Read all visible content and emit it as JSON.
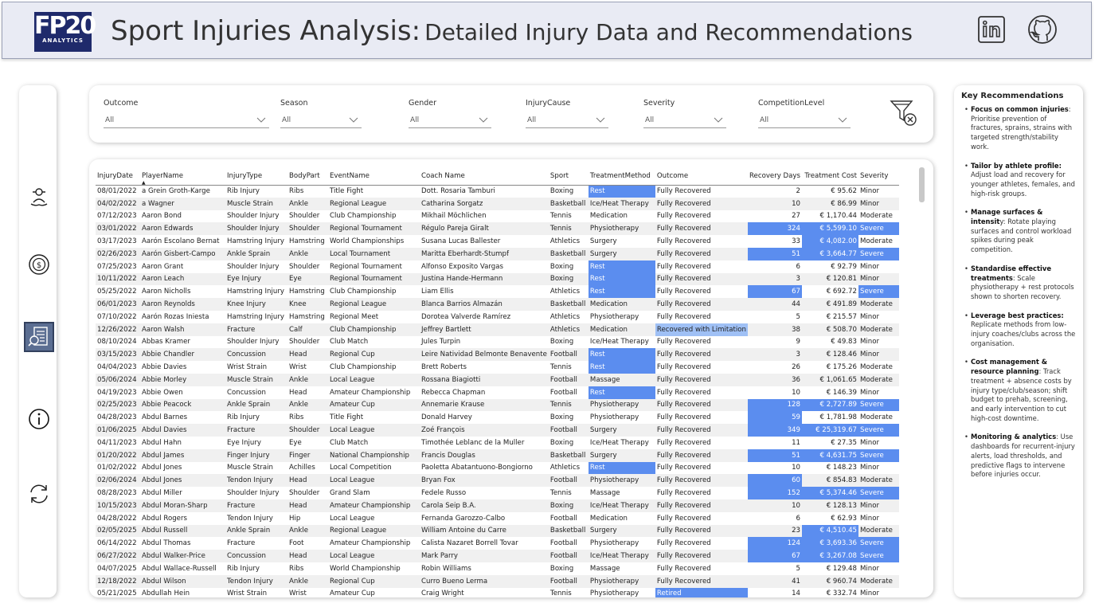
{
  "header": {
    "logo_text": "FP20",
    "logo_sub": "ANALYTICS",
    "title_main": "Sport Injuries Analysis:",
    "title_sub": "Detailed Injury Data and Recommendations",
    "icons": [
      "linkedin-icon",
      "github-icon"
    ]
  },
  "nav": {
    "items": [
      "rehab-icon",
      "cost-icon",
      "report-icon",
      "info-icon",
      "refresh-icon"
    ],
    "active": "report-icon"
  },
  "filters": [
    {
      "label": "Outcome",
      "value": "All"
    },
    {
      "label": "Season",
      "value": "All"
    },
    {
      "label": "Gender",
      "value": "All"
    },
    {
      "label": "InjuryCause",
      "value": "All"
    },
    {
      "label": "Severity",
      "value": "All"
    },
    {
      "label": "CompetitionLevel",
      "value": "All"
    }
  ],
  "table": {
    "columns": [
      "InjuryDate",
      "PlayerName",
      "InjuryType",
      "BodyPart",
      "EventName",
      "Coach Name",
      "Sport",
      "TreatmentMethod",
      "Outcome",
      "Recovery Days",
      "Treatment Cost",
      "Severity"
    ],
    "rows": [
      [
        "08/01/2022",
        "a Grein Groth-Karge",
        "Rib Injury",
        "Ribs",
        "Title Fight",
        "Dott. Rosaria Tamburi",
        "Boxing",
        "Rest",
        "Fully Recovered",
        "2",
        "€ 95.62",
        "Minor"
      ],
      [
        "04/02/2022",
        "a Wagner",
        "Muscle Strain",
        "Ankle",
        "Regional League",
        "Catharina Sorgatz",
        "Basketball",
        "Ice/Heat Therapy",
        "Fully Recovered",
        "10",
        "€ 86.99",
        "Minor"
      ],
      [
        "07/12/2023",
        "Aaron Bond",
        "Shoulder Injury",
        "Shoulder",
        "Club Championship",
        "Mikhail Möchlichen",
        "Tennis",
        "Medication",
        "Fully Recovered",
        "27",
        "€ 1,170.44",
        "Moderate"
      ],
      [
        "03/01/2022",
        "Aaron Edwards",
        "Shoulder Injury",
        "Shoulder",
        "Regional Tournament",
        "Régulo Pareja Giralt",
        "Tennis",
        "Physiotherapy",
        "Fully Recovered",
        "324",
        "€ 5,599.10",
        "Severe"
      ],
      [
        "03/17/2023",
        "Aarón Escolano Bernat",
        "Hamstring Injury",
        "Hamstring",
        "World Championships",
        "Susana Lucas Ballester",
        "Athletics",
        "Surgery",
        "Fully Recovered",
        "33",
        "€ 4,082.00",
        "Moderate"
      ],
      [
        "02/26/2023",
        "Aarón Gisbert-Campo",
        "Ankle Sprain",
        "Ankle",
        "Local Tournament",
        "Maritta Eberhardt-Stumpf",
        "Basketball",
        "Surgery",
        "Fully Recovered",
        "51",
        "€ 3,664.77",
        "Severe"
      ],
      [
        "07/25/2023",
        "Aaron Grant",
        "Shoulder Injury",
        "Shoulder",
        "Regional Tournament",
        "Alfonso Exposito Vargas",
        "Boxing",
        "Rest",
        "Fully Recovered",
        "6",
        "€ 92.79",
        "Minor"
      ],
      [
        "10/11/2022",
        "Aaron Leach",
        "Eye Injury",
        "Eye",
        "Regional Tournament",
        "Justina Hande-Hermann",
        "Boxing",
        "Rest",
        "Fully Recovered",
        "3",
        "€ 120.81",
        "Minor"
      ],
      [
        "05/25/2022",
        "Aaron Nicholls",
        "Hamstring Injury",
        "Hamstring",
        "Club Championship",
        "Liam Ellis",
        "Athletics",
        "Rest",
        "Fully Recovered",
        "67",
        "€ 692.72",
        "Severe"
      ],
      [
        "06/01/2023",
        "Aaron Reynolds",
        "Knee Injury",
        "Knee",
        "Regional League",
        "Blanca Barrios Almazán",
        "Basketball",
        "Medication",
        "Fully Recovered",
        "44",
        "€ 491.89",
        "Moderate"
      ],
      [
        "07/10/2022",
        "Aarón Rozas Iniesta",
        "Hamstring Injury",
        "Hamstring",
        "Regional Meet",
        "Dorotea Valverde Ramírez",
        "Athletics",
        "Physiotherapy",
        "Fully Recovered",
        "5",
        "€ 215.57",
        "Minor"
      ],
      [
        "12/26/2022",
        "Aaron Walsh",
        "Fracture",
        "Calf",
        "Club Championship",
        "Jeffrey Bartlett",
        "Athletics",
        "Medication",
        "Recovered with Limitation",
        "38",
        "€ 508.70",
        "Moderate"
      ],
      [
        "08/10/2024",
        "Abbas Kramer",
        "Shoulder Injury",
        "Shoulder",
        "Club Match",
        "Jules Turpin",
        "Boxing",
        "Ice/Heat Therapy",
        "Fully Recovered",
        "9",
        "€ 49.83",
        "Minor"
      ],
      [
        "03/15/2023",
        "Abbie Chandler",
        "Concussion",
        "Head",
        "Regional Cup",
        "Leire Natividad Belmonte Benavente",
        "Football",
        "Rest",
        "Fully Recovered",
        "3",
        "€ 128.46",
        "Minor"
      ],
      [
        "04/04/2023",
        "Abbie Davies",
        "Wrist Strain",
        "Wrist",
        "Club Championship",
        "Brett Roberts",
        "Tennis",
        "Rest",
        "Fully Recovered",
        "26",
        "€ 175.26",
        "Moderate"
      ],
      [
        "05/06/2024",
        "Abbie Morley",
        "Muscle Strain",
        "Ankle",
        "Local League",
        "Rossana Biagiotti",
        "Football",
        "Massage",
        "Fully Recovered",
        "36",
        "€ 1,061.65",
        "Moderate"
      ],
      [
        "04/19/2023",
        "Abbie Owen",
        "Concussion",
        "Head",
        "Amateur Championship",
        "Rebecca Chapman",
        "Football",
        "Rest",
        "Fully Recovered",
        "10",
        "€ 146.39",
        "Minor"
      ],
      [
        "02/25/2023",
        "Abbie Peacock",
        "Ankle Sprain",
        "Ankle",
        "Amateur Cup",
        "Annemarie Krause",
        "Tennis",
        "Physiotherapy",
        "Fully Recovered",
        "128",
        "€ 2,727.89",
        "Severe"
      ],
      [
        "04/28/2023",
        "Abdul Barnes",
        "Rib Injury",
        "Ribs",
        "Title Fight",
        "Donald Harvey",
        "Boxing",
        "Physiotherapy",
        "Fully Recovered",
        "59",
        "€ 1,781.98",
        "Moderate"
      ],
      [
        "01/06/2025",
        "Abdul Davies",
        "Fracture",
        "Shoulder",
        "Local League",
        "Zoé François",
        "Football",
        "Surgery",
        "Fully Recovered",
        "349",
        "€ 25,319.67",
        "Severe"
      ],
      [
        "04/11/2023",
        "Abdul Hahn",
        "Eye Injury",
        "Eye",
        "Club Match",
        "Timothée Leblanc de la Muller",
        "Boxing",
        "Ice/Heat Therapy",
        "Fully Recovered",
        "11",
        "€ 27.35",
        "Minor"
      ],
      [
        "01/20/2022",
        "Abdul James",
        "Finger Injury",
        "Finger",
        "National Championship",
        "Francis Douglas",
        "Basketball",
        "Surgery",
        "Fully Recovered",
        "51",
        "€ 4,631.75",
        "Severe"
      ],
      [
        "01/02/2022",
        "Abdul Jones",
        "Muscle Strain",
        "Achilles",
        "Local Competition",
        "Paoletta Abatantuono-Bongiorno",
        "Athletics",
        "Rest",
        "Fully Recovered",
        "10",
        "€ 148.23",
        "Minor"
      ],
      [
        "02/06/2024",
        "Abdul Jones",
        "Tendon Injury",
        "Head",
        "Local League",
        "Bryan Fox",
        "Football",
        "Physiotherapy",
        "Fully Recovered",
        "60",
        "€ 854.83",
        "Moderate"
      ],
      [
        "08/28/2023",
        "Abdul Miller",
        "Shoulder Injury",
        "Shoulder",
        "Grand Slam",
        "Fedele Russo",
        "Tennis",
        "Massage",
        "Fully Recovered",
        "152",
        "€ 5,374.46",
        "Severe"
      ],
      [
        "10/15/2023",
        "Abdul Moran-Sharp",
        "Fracture",
        "Head",
        "Amateur Championship",
        "Carola Seip B.A.",
        "Boxing",
        "Ice/Heat Therapy",
        "Fully Recovered",
        "10",
        "€ 128.13",
        "Minor"
      ],
      [
        "04/28/2022",
        "Abdul Rogers",
        "Tendon Injury",
        "Hip",
        "Local League",
        "Fernanda Garozzo-Calbo",
        "Football",
        "Medication",
        "Fully Recovered",
        "6",
        "€ 62.93",
        "Minor"
      ],
      [
        "02/05/2025",
        "Abdul Russell",
        "Ankle Sprain",
        "Ankle",
        "Regional League",
        "William Antoine du Carre",
        "Basketball",
        "Surgery",
        "Fully Recovered",
        "23",
        "€ 4,510.45",
        "Moderate"
      ],
      [
        "06/14/2022",
        "Abdul Thomas",
        "Fracture",
        "Foot",
        "Amateur Championship",
        "Calista Nazaret Borrell Tovar",
        "Football",
        "Physiotherapy",
        "Fully Recovered",
        "124",
        "€ 3,693.36",
        "Severe"
      ],
      [
        "06/27/2022",
        "Abdul Walker-Price",
        "Concussion",
        "Head",
        "Local League",
        "Mark Parry",
        "Football",
        "Ice/Heat Therapy",
        "Fully Recovered",
        "67",
        "€ 3,267.08",
        "Severe"
      ],
      [
        "04/07/2025",
        "Abdul Wallace-Russell",
        "Rib Injury",
        "Ribs",
        "World Championship",
        "Robin Williams",
        "Boxing",
        "Massage",
        "Fully Recovered",
        "5",
        "€ 129.48",
        "Minor"
      ],
      [
        "12/18/2022",
        "Abdul Wilson",
        "Tendon Injury",
        "Ankle",
        "Regional Cup",
        "Curro Bueno Lerma",
        "Football",
        "Physiotherapy",
        "Fully Recovered",
        "41",
        "€ 960.74",
        "Moderate"
      ],
      [
        "05/21/2025",
        "Abdullah Hein",
        "Wrist Strain",
        "Wrist",
        "Amateur Cup",
        "Craig Wright",
        "Tennis",
        "Physiotherapy",
        "Retired",
        "14",
        "€ 332.74",
        "Minor"
      ]
    ]
  },
  "recommendations": {
    "title": "Key Recommendations",
    "items": [
      {
        "head": "Focus on common injuries",
        "body": ": Prioritise prevention of fractures, sprains, strains with targeted strength/stability work."
      },
      {
        "head": "Tailor by athlete profile:",
        "body": " Adjust load and recovery for younger athletes, females, and high-risk groups."
      },
      {
        "head": "Manage surfaces & intensit",
        "body": "y: Rotate playing surfaces and control workload spikes during peak competition."
      },
      {
        "head": "Standardise effective treatments",
        "body": ": Scale physiotherapy + rest protocols shown to shorten recovery."
      },
      {
        "head": "Leverage best practices:",
        "body": " Replicate methods from low-injury coaches/clubs across the organisation."
      },
      {
        "head": "Cost management & resource planning",
        "body": ": Track treatment + absence costs by injury type/club/season; shift budget to prehab, screening, and early intervention to cut high-cost downtime."
      },
      {
        "head": "Monitoring & analytics",
        "body": ": Use dashboards for recurrent-injury alerts, load thresholds, and predictive flags to intervene before injuries occur."
      }
    ]
  },
  "colors": {
    "highlight": "#5b8def",
    "highlight_light": "#9fc0f5",
    "header_bg": "#e9ebf4",
    "nav_active": "#5b6e92"
  }
}
